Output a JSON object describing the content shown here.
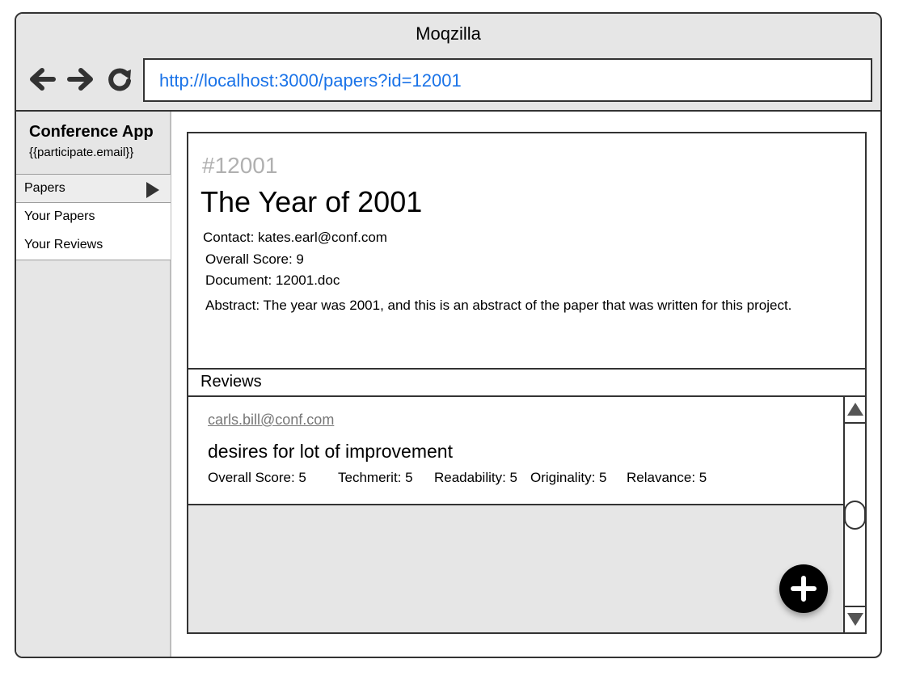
{
  "browser": {
    "title": "Moqzilla",
    "url": "http://localhost:3000/papers?id=12001"
  },
  "sidebar": {
    "app_title": "Conference App",
    "user": "{{participate.email}}",
    "items": [
      {
        "label": "Papers",
        "icon": "chevron-right-icon"
      },
      {
        "label": "Your Papers"
      },
      {
        "label": "Your Reviews"
      }
    ]
  },
  "paper": {
    "id": "#12001",
    "title": "The Year of 2001",
    "contact": "Contact: kates.earl@conf.com",
    "overall_score": "Overall Score: 9",
    "document": "Document: 12001.doc",
    "abstract": "Abstract: The year was 2001, and this is an abstract of the paper that was written for this project."
  },
  "reviews": {
    "header": "Reviews",
    "items": [
      {
        "email": "carls.bill@conf.com",
        "comment": "desires for lot of improvement",
        "overall_score": "Overall Score: 5",
        "techmerit": "Techmerit: 5",
        "readability": "Readability: 5",
        "originality": "Originality: 5",
        "relavance": "Relavance: 5"
      }
    ]
  },
  "colors": {
    "chrome_bg": "#e6e6e6",
    "url_text": "#1a73e8",
    "muted_id": "#b0b0b0",
    "fab_bg": "#000000"
  },
  "icons": [
    "back-arrow-icon",
    "forward-arrow-icon",
    "reload-icon",
    "chevron-right-icon",
    "scroll-up-icon",
    "scroll-down-icon",
    "plus-icon"
  ]
}
